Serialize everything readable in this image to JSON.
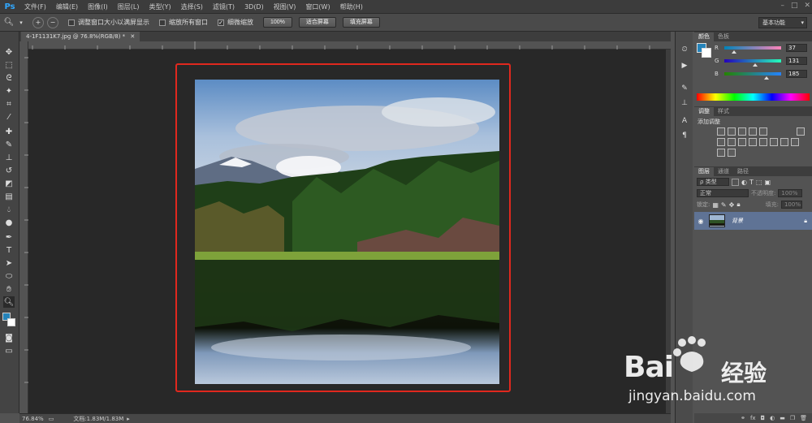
{
  "app": {
    "logo": "Ps"
  },
  "menu": [
    "文件(F)",
    "编辑(E)",
    "图像(I)",
    "图层(L)",
    "类型(Y)",
    "选择(S)",
    "滤镜(T)",
    "3D(D)",
    "视图(V)",
    "窗口(W)",
    "帮助(H)"
  ],
  "options": {
    "check1": "调整窗口大小以满屏显示",
    "check2": "缩放所有窗口",
    "check3": "细微缩放",
    "zoom_btn": "100%",
    "fit_btn": "适合屏幕",
    "fill_btn": "填充屏幕",
    "workspace": "基本功能"
  },
  "document": {
    "tab": "4-1F1131K7.jpg @ 76.8%(RGB/8) *"
  },
  "status": {
    "zoom": "76.84%",
    "doc": "文档:1.83M/1.83M"
  },
  "color_panel": {
    "tabs": [
      "颜色",
      "色板"
    ],
    "r_label": "R",
    "r": "37",
    "g_label": "G",
    "g": "131",
    "b_label": "B",
    "b": "185",
    "fg": "#2583b9"
  },
  "adjust_panel": {
    "tabs": [
      "调整",
      "样式"
    ],
    "title": "添加调整"
  },
  "layers_panel": {
    "tabs": [
      "图层",
      "通道",
      "路径"
    ],
    "kind": "类型",
    "blend": "正常",
    "opacity_label": "不透明度:",
    "opacity": "100%",
    "lock_label": "锁定:",
    "fill_label": "填充:",
    "fill": "100%",
    "layer_name": "背景"
  },
  "watermark": {
    "brand_text": "Bai",
    "brand_text2": "经验",
    "url": "jingyan.baidu.com"
  }
}
